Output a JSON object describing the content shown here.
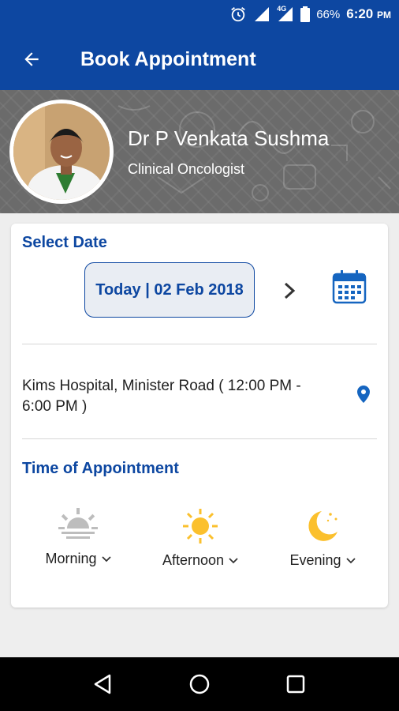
{
  "status_bar": {
    "network": "4G",
    "battery": "66%",
    "time": "6:20",
    "time_suffix": "PM"
  },
  "app_bar": {
    "title": "Book Appointment"
  },
  "doctor": {
    "name": "Dr P Venkata Sushma",
    "specialty": "Clinical Oncologist"
  },
  "date_section": {
    "title": "Select Date",
    "selected_date": "Today | 02 Feb 2018"
  },
  "location": {
    "text": "Kims Hospital, Minister Road ( 12:00 PM - 6:00 PM )"
  },
  "time_section": {
    "title": "Time of Appointment",
    "slots": [
      {
        "label": "Morning",
        "icon": "sunrise-icon",
        "enabled": false
      },
      {
        "label": "Afternoon",
        "icon": "sun-icon",
        "enabled": true
      },
      {
        "label": "Evening",
        "icon": "moon-icon",
        "enabled": true
      }
    ]
  },
  "colors": {
    "primary": "#0d47a1",
    "accent_yellow": "#fbc02d",
    "disabled_gray": "#bdbdbd",
    "location_pin": "#1565c0"
  }
}
